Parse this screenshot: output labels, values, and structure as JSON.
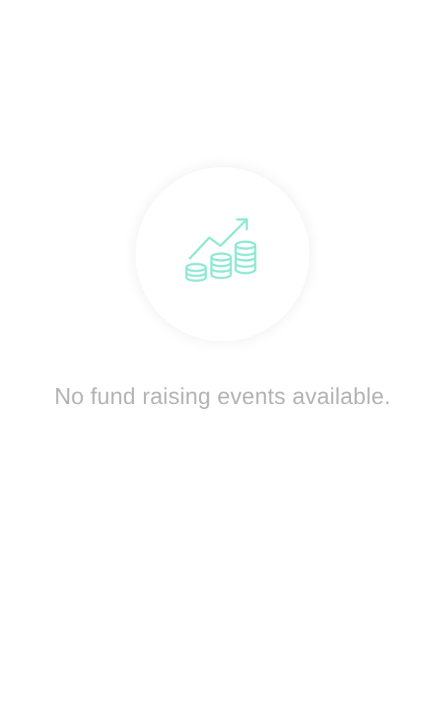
{
  "empty_state": {
    "icon": "growth-coins-icon",
    "accent_color": "#8ee8d3",
    "message": "No fund raising events available."
  }
}
